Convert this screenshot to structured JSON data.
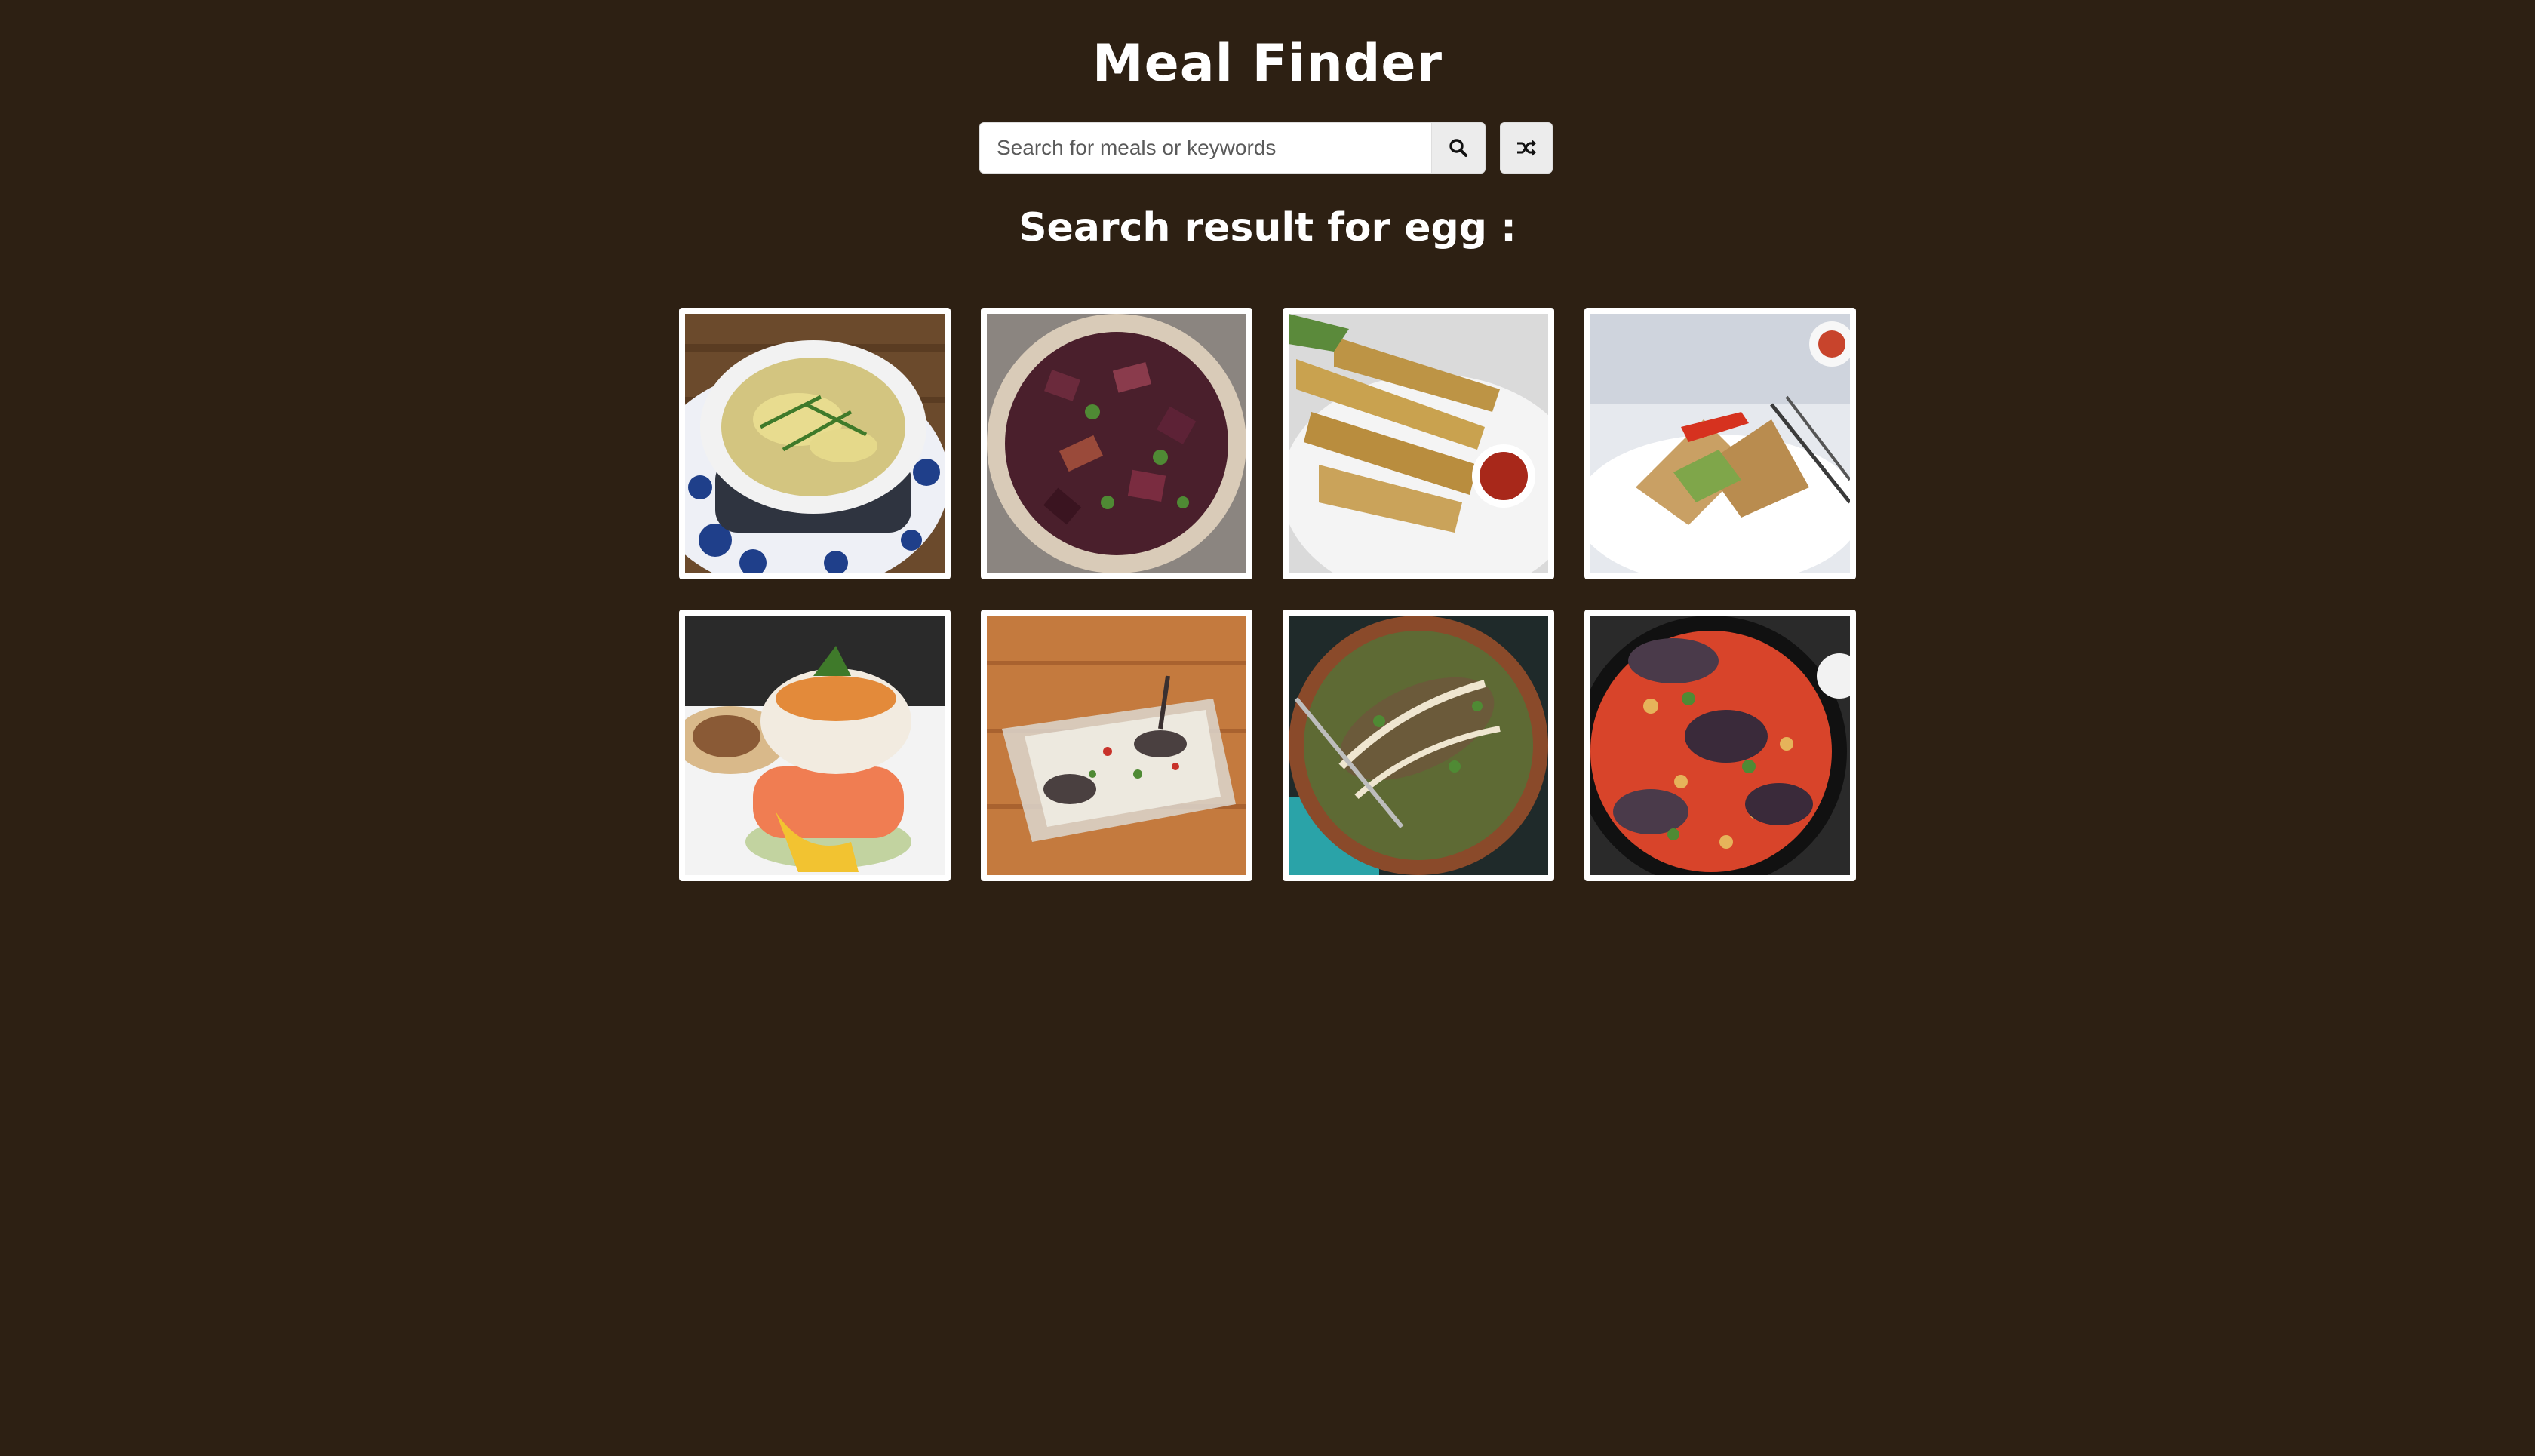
{
  "app": {
    "title": "Meal Finder"
  },
  "search": {
    "placeholder": "Search for meals or keywords",
    "value": "",
    "search_icon": "search-icon",
    "random_icon": "random-shuffle-icon"
  },
  "results": {
    "heading": "Search result for egg :"
  },
  "meals": [
    {
      "photo": "egg-drop-soup-photo"
    },
    {
      "photo": "eggplant-stir-fry-photo"
    },
    {
      "photo": "fried-eggplant-strips-photo"
    },
    {
      "photo": "egg-wrap-plate-photo"
    },
    {
      "photo": "eggs-benedict-salmon-photo"
    },
    {
      "photo": "eggplant-yogurt-dish-photo"
    },
    {
      "photo": "eggplant-lentil-bowl-photo"
    },
    {
      "photo": "eggplant-tomato-skillet-photo"
    }
  ],
  "colors": {
    "background": "#2d2013",
    "text": "#ffffff",
    "button": "#ececec"
  }
}
